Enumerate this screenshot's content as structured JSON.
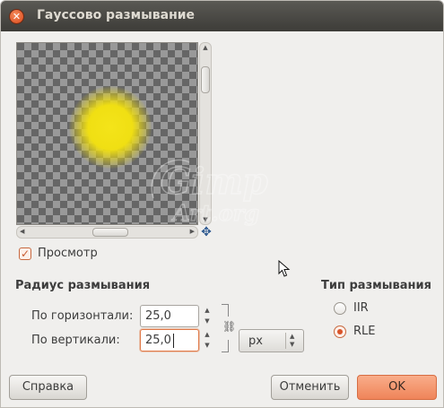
{
  "window": {
    "title": "Гауссово размывание",
    "close_glyph": "✕"
  },
  "preview": {
    "checkbox_label": "Просмотр",
    "checkbox_checked": true,
    "blob_color": "#f2e015"
  },
  "radius": {
    "section_title": "Радиус размывания",
    "horizontal_label": "По горизонтали:",
    "horizontal_value": "25,0",
    "vertical_label": "По вертикали:",
    "vertical_value": "25,0",
    "unit": "px",
    "chain_linked": true
  },
  "blur_type": {
    "section_title": "Тип размывания",
    "options": [
      {
        "label": "IIR",
        "selected": false
      },
      {
        "label": "RLE",
        "selected": true
      }
    ]
  },
  "buttons": {
    "help": "Справка",
    "cancel": "Отменить",
    "ok": "OK"
  },
  "watermark": {
    "line1": "Gimp",
    "line2": "Art.org"
  },
  "colors": {
    "accent": "#ef8459",
    "titlebar": "#3d3c38"
  }
}
